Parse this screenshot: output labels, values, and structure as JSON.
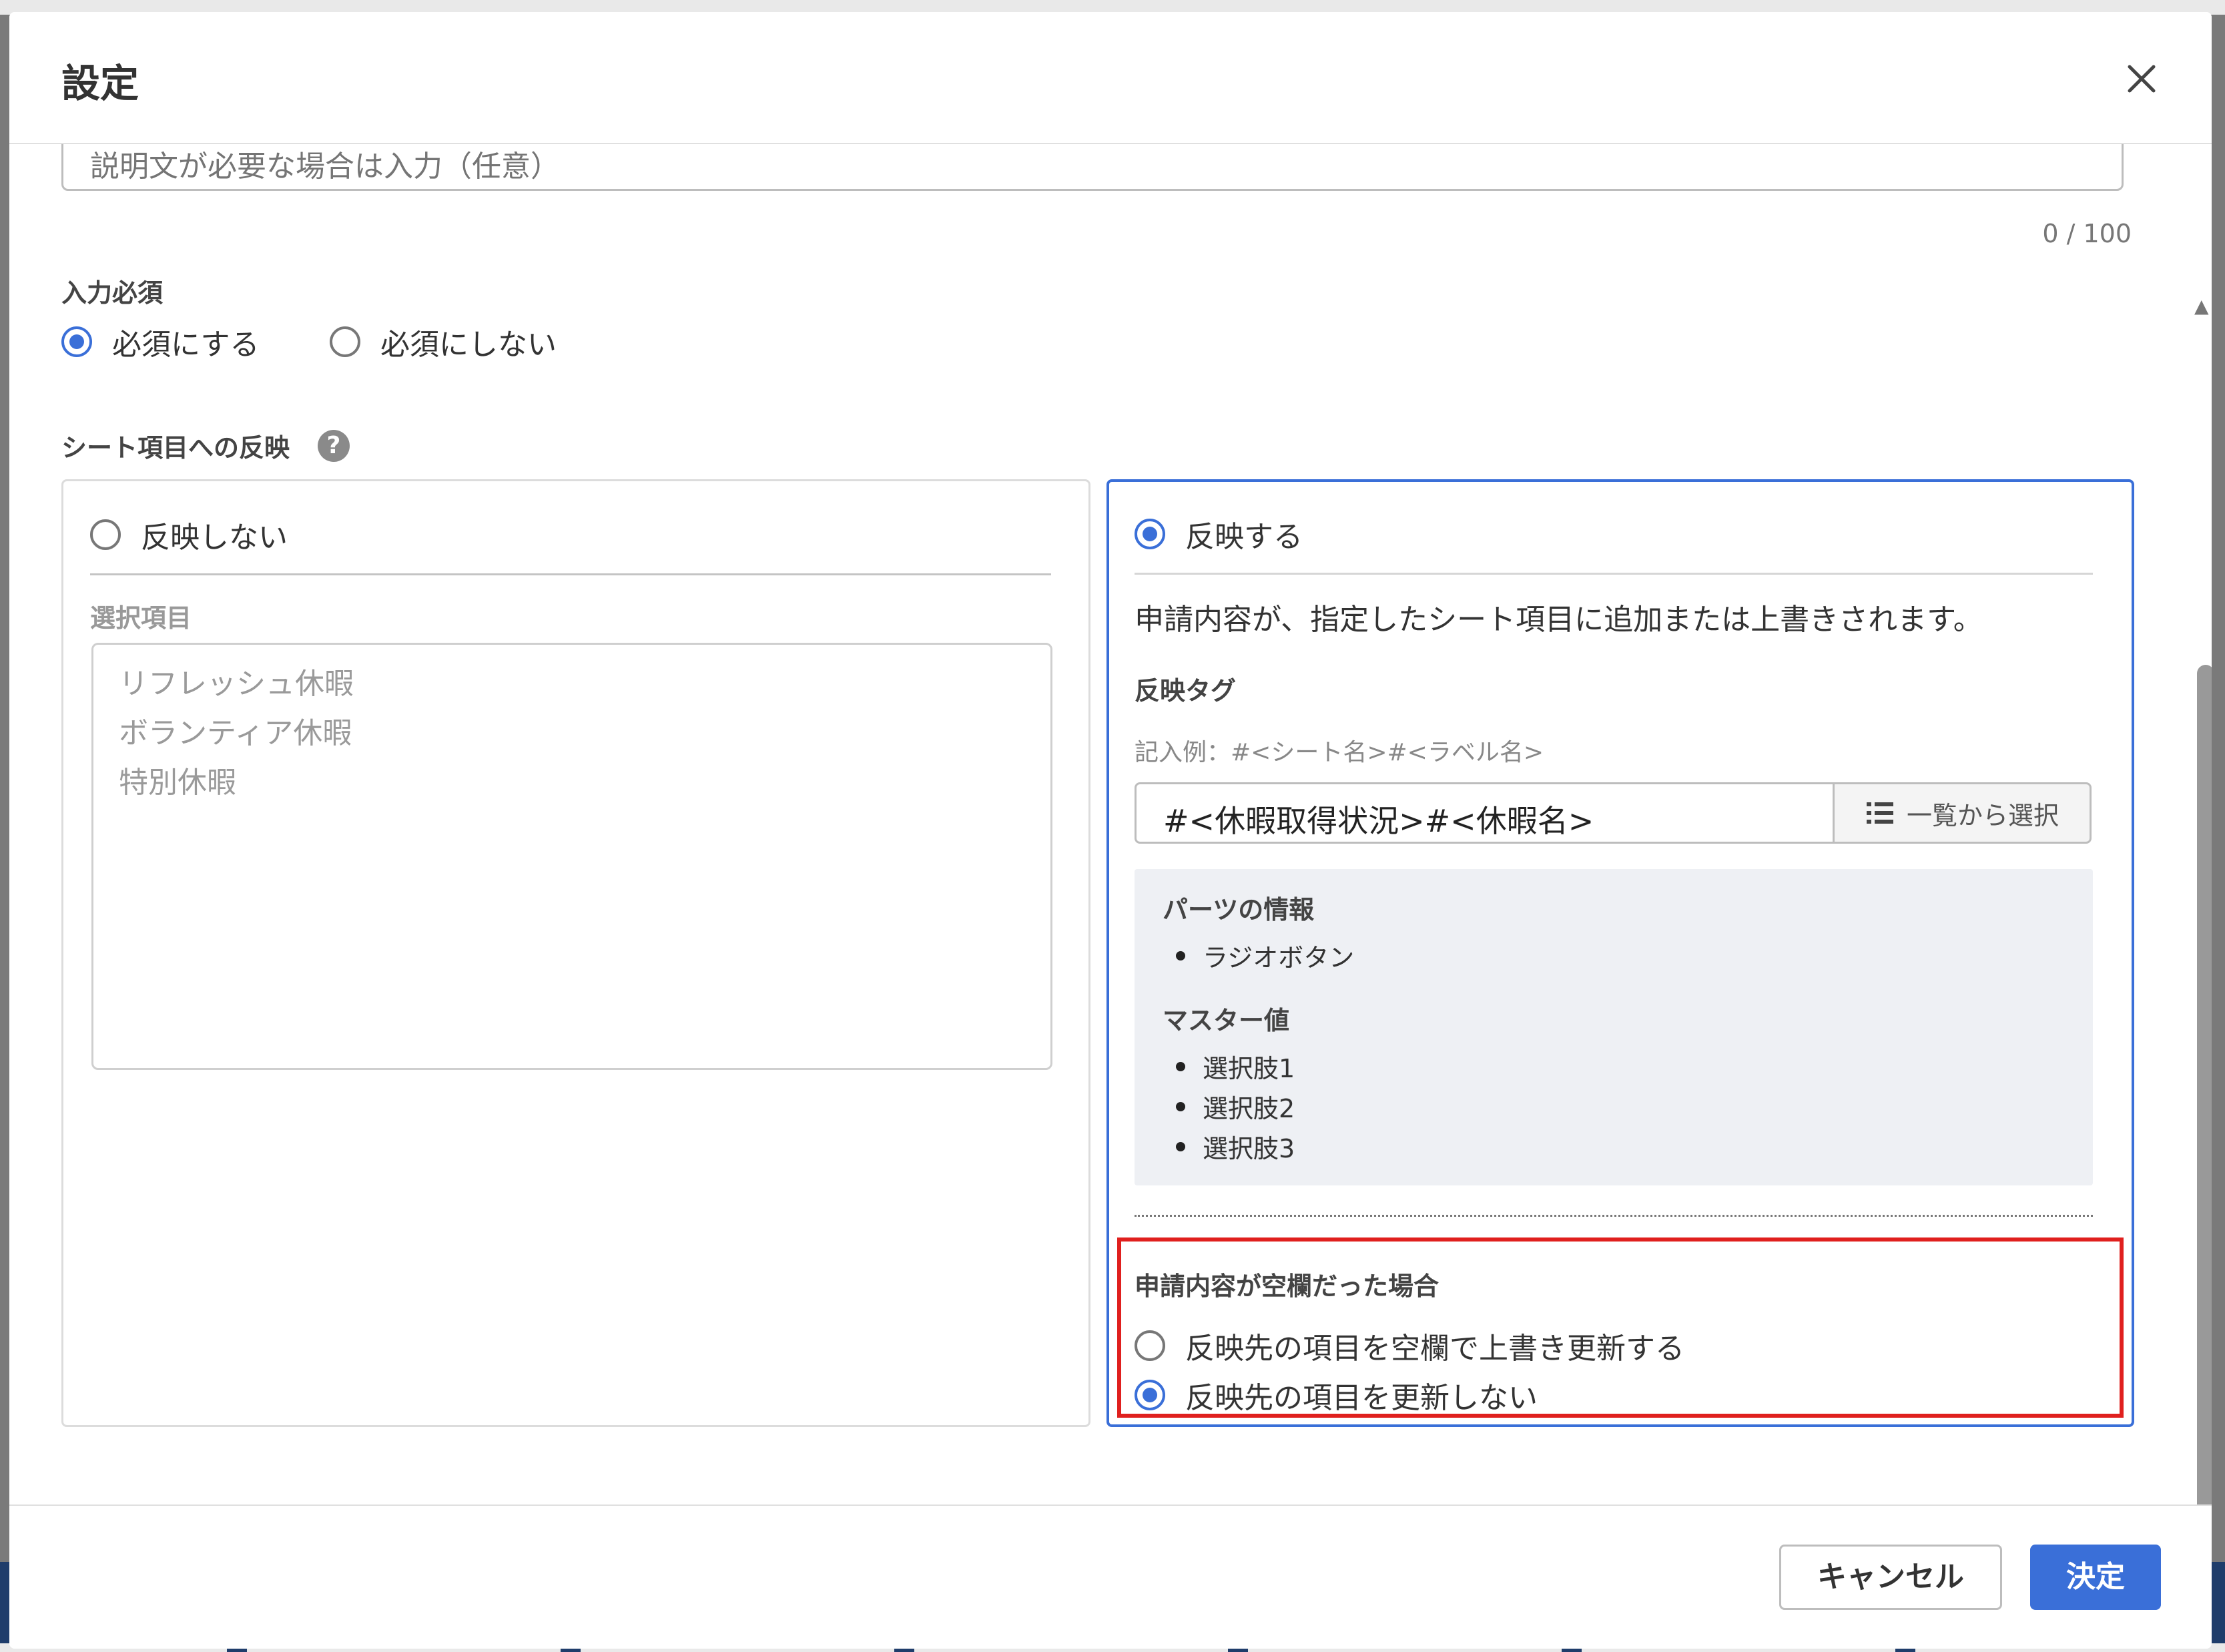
{
  "dialog": {
    "title": "設定",
    "description": {
      "placeholder": "説明文が必要な場合は入力（任意）",
      "counter": "0 / 100"
    },
    "required": {
      "label": "入力必須",
      "options": [
        "必須にする",
        "必須にしない"
      ],
      "selected": "必須にする"
    },
    "reflect": {
      "label": "シート項目への反映",
      "help_icon": "?",
      "left": {
        "option": "反映しない",
        "list_label": "選択項目",
        "items": [
          "リフレッシュ休暇",
          "ボランティア休暇",
          "特別休暇"
        ]
      },
      "right": {
        "option": "反映する",
        "description": "申請内容が、指定したシート項目に追加または上書きされます。",
        "tag_label": "反映タグ",
        "example": "記入例：#<シート名>#<ラベル名>",
        "tag_value": "#<休暇取得状況>#<休暇名>",
        "select_button": "一覧から選択",
        "parts_info": {
          "title": "パーツの情報",
          "items": [
            "ラジオボタン"
          ]
        },
        "master": {
          "title": "マスター値",
          "items": [
            "選択肢1",
            "選択肢2",
            "選択肢3"
          ]
        },
        "blank_case": {
          "title": "申請内容が空欄だった場合",
          "options": [
            "反映先の項目を空欄で上書き更新する",
            "反映先の項目を更新しない"
          ],
          "selected": "反映先の項目を更新しない"
        }
      },
      "selected": "反映する"
    },
    "footer": {
      "cancel": "キャンセル",
      "ok": "決定"
    }
  },
  "colors": {
    "accent": "#3a6fd8",
    "highlight": "#e0201e"
  }
}
